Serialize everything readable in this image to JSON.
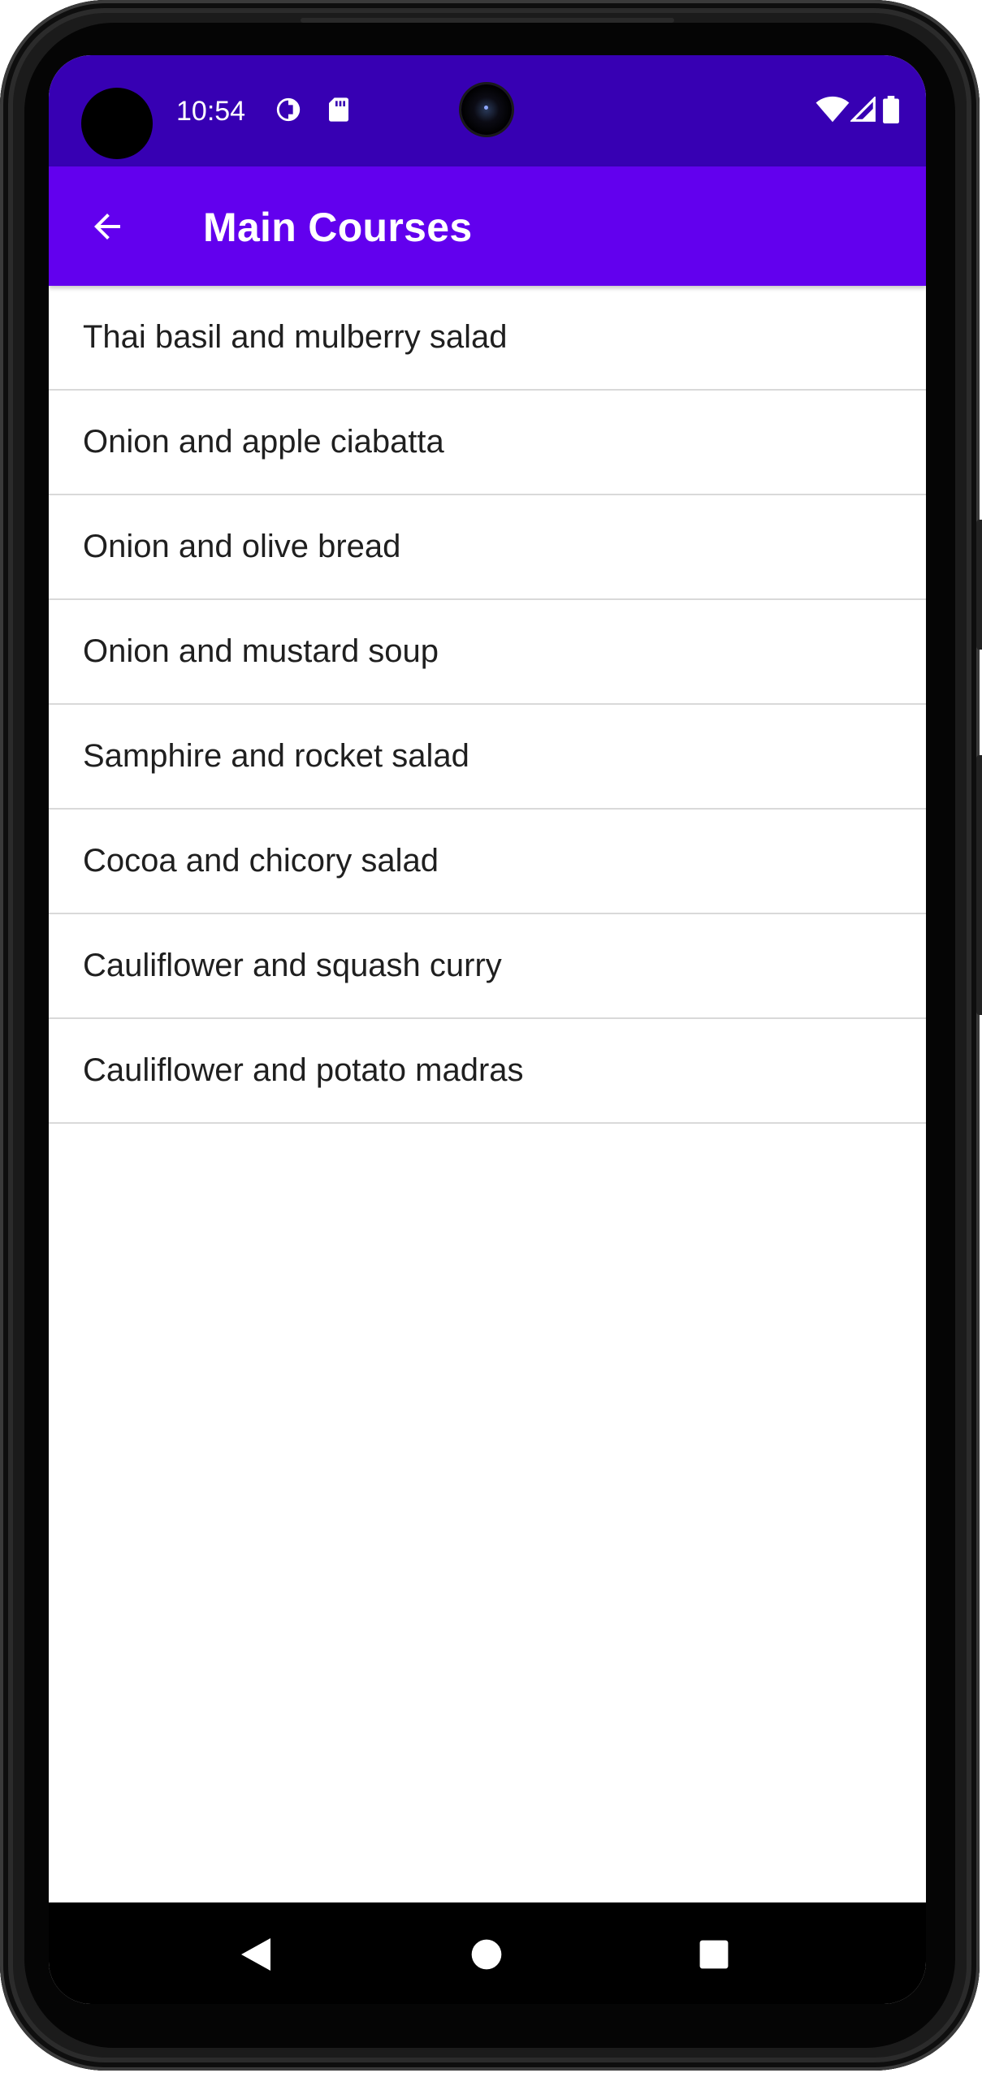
{
  "status_bar": {
    "time": "10:54",
    "icons": [
      "data-saver-icon",
      "sd-card-icon",
      "wifi-icon",
      "cell-signal-icon",
      "battery-icon"
    ]
  },
  "app_bar": {
    "title": "Main Courses",
    "back_icon": "arrow-back-icon"
  },
  "colors": {
    "status_bar": "#3700b3",
    "app_bar": "#6200ee",
    "divider": "#d9d9d9"
  },
  "courses": [
    "Thai basil and mulberry salad",
    "Onion and apple ciabatta",
    "Onion and olive bread",
    "Onion and mustard soup",
    "Samphire and rocket salad",
    "Cocoa and chicory salad",
    "Cauliflower and squash curry",
    "Cauliflower and potato madras"
  ],
  "nav_bar": {
    "icons": [
      "back-triangle-icon",
      "home-circle-icon",
      "recents-square-icon"
    ]
  }
}
